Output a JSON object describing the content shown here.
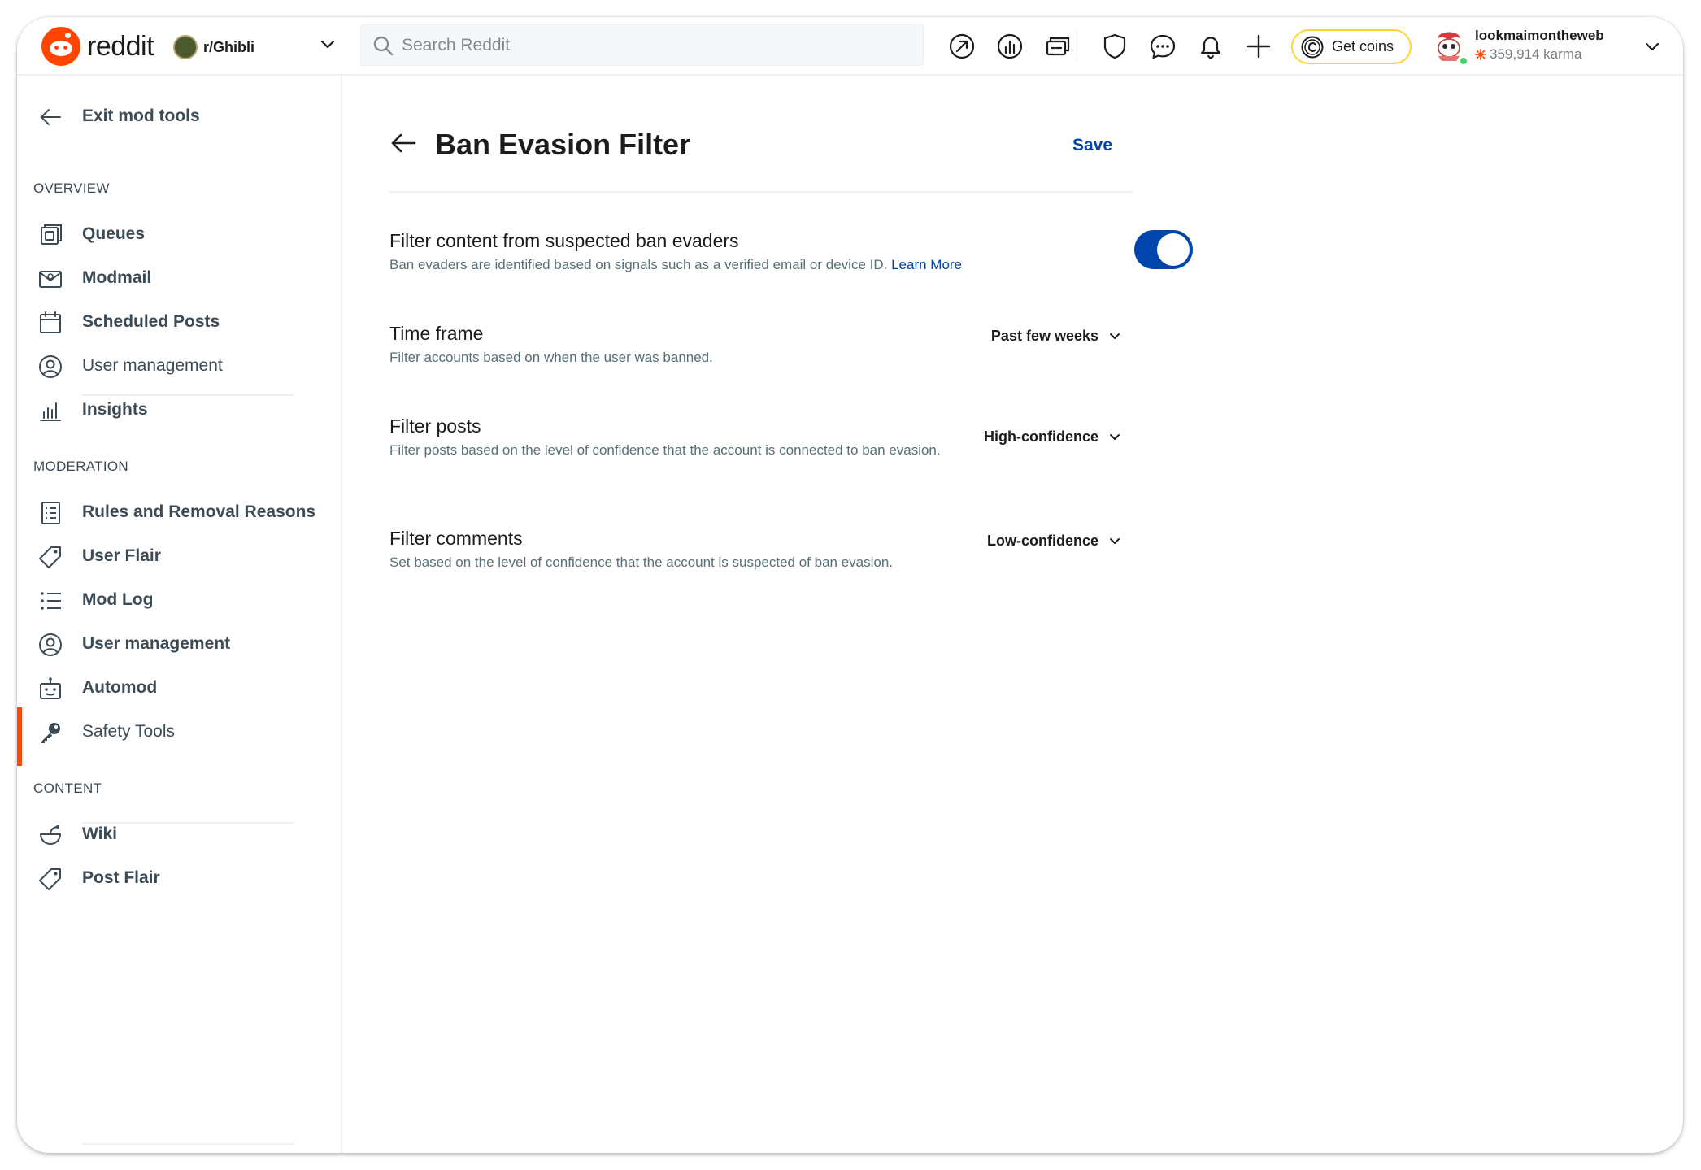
{
  "header": {
    "logo_text": "reddit",
    "community": "r/Ghibli",
    "search_placeholder": "Search Reddit",
    "get_coins": "Get coins",
    "user": {
      "name": "lookmaimontheweb",
      "karma": "359,914 karma"
    },
    "icons": [
      "popular-icon",
      "stats-icon",
      "mod-queue-icon",
      "shield-icon",
      "chat-icon",
      "notification-icon",
      "plus-icon"
    ]
  },
  "sidebar": {
    "exit": "Exit mod tools",
    "overview_title": "OVERVIEW",
    "overview": [
      {
        "label": "Queues"
      },
      {
        "label": "Modmail"
      },
      {
        "label": "Scheduled Posts"
      },
      {
        "label": "User management"
      },
      {
        "label": "Insights"
      }
    ],
    "moderation_title": "MODERATION",
    "moderation": [
      {
        "label": "Rules and Removal Reasons"
      },
      {
        "label": "User Flair"
      },
      {
        "label": "Mod Log"
      },
      {
        "label": "User management"
      },
      {
        "label": "Automod"
      },
      {
        "label": "Safety Tools"
      }
    ],
    "content_title": "CONTENT",
    "content": [
      {
        "label": "Wiki"
      },
      {
        "label": "Post Flair"
      }
    ]
  },
  "main": {
    "title": "Ban Evasion Filter",
    "save": "Save",
    "toggle_setting": {
      "title": "Filter content from suspected ban evaders",
      "description": "Ban evaders are identified based on signals such as a verified email or device ID.",
      "learn_more": "Learn More",
      "enabled": true
    },
    "time_frame": {
      "title": "Time frame",
      "description": "Filter accounts based on when the user was banned.",
      "value": "Past few weeks"
    },
    "filter_posts": {
      "title": "Filter posts",
      "description": "Filter posts based on the level of confidence that the account is connected to ban evasion.",
      "value": "High-confidence"
    },
    "filter_comments": {
      "title": "Filter comments",
      "description": "Set based on the level of confidence that the account is suspected of ban evasion.",
      "value": "Low-confidence"
    }
  },
  "colors": {
    "brand": "#ff4500",
    "accent": "#0045ac",
    "coins_border": "#ffd635"
  }
}
